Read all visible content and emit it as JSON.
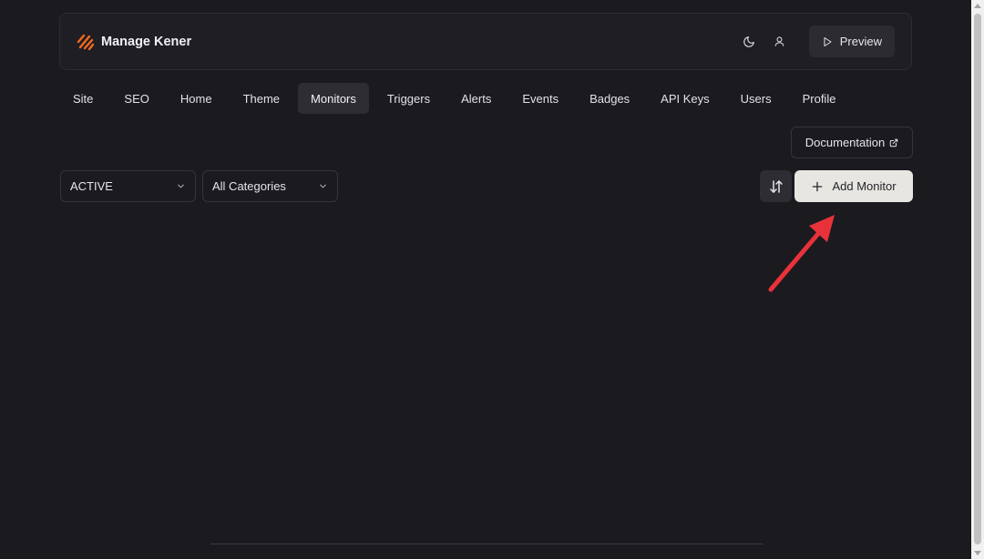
{
  "header": {
    "brand_title": "Manage Kener",
    "brand_icon": "kener-logo-icon",
    "theme_icon": "moon-icon",
    "profile_icon": "user-icon",
    "preview_label": "Preview",
    "preview_icon": "play-icon"
  },
  "nav": {
    "tabs": [
      {
        "label": "Site",
        "active": false
      },
      {
        "label": "SEO",
        "active": false
      },
      {
        "label": "Home",
        "active": false
      },
      {
        "label": "Theme",
        "active": false
      },
      {
        "label": "Monitors",
        "active": true
      },
      {
        "label": "Triggers",
        "active": false
      },
      {
        "label": "Alerts",
        "active": false
      },
      {
        "label": "Events",
        "active": false
      },
      {
        "label": "Badges",
        "active": false
      },
      {
        "label": "API Keys",
        "active": false
      },
      {
        "label": "Users",
        "active": false
      },
      {
        "label": "Profile",
        "active": false
      }
    ]
  },
  "toolbar": {
    "documentation_label": "Documentation",
    "documentation_icon": "external-link-icon",
    "status_filter_value": "ACTIVE",
    "category_filter_value": "All Categories",
    "sort_icon": "sort-arrows-icon",
    "add_monitor_label": "Add Monitor",
    "add_icon": "plus-icon"
  },
  "colors": {
    "background": "#1b1a1f",
    "brand_accent": "#f26a1b",
    "annotation_arrow": "#e8323a",
    "primary_button": "#e7e6e1"
  }
}
